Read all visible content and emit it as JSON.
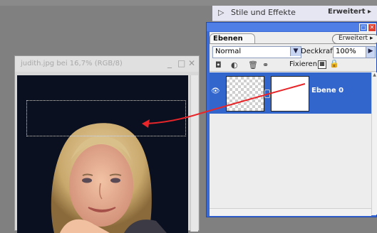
{
  "styles_bar": {
    "title": "Stile und Effekte",
    "more_label": "Erweitert ▸"
  },
  "document": {
    "title": "judith.jpg bei 16,7% (RGB/8)",
    "controls": {
      "minimize": "_",
      "maximize": "□",
      "close": "✕"
    }
  },
  "layers_panel": {
    "tab_label": "Ebenen",
    "more_label": "Erweitert ▸",
    "blend_mode": "Normal",
    "opacity_label": "Deckkraft:",
    "opacity_value": "100%",
    "lock_label": "Fixieren:",
    "layers": [
      {
        "name": "Ebene 0",
        "visible": true,
        "selected": true
      }
    ]
  },
  "colors": {
    "panel_blue": "#3a6ad6",
    "selected_layer": "#3366cc",
    "arrow": "#e8262a"
  }
}
